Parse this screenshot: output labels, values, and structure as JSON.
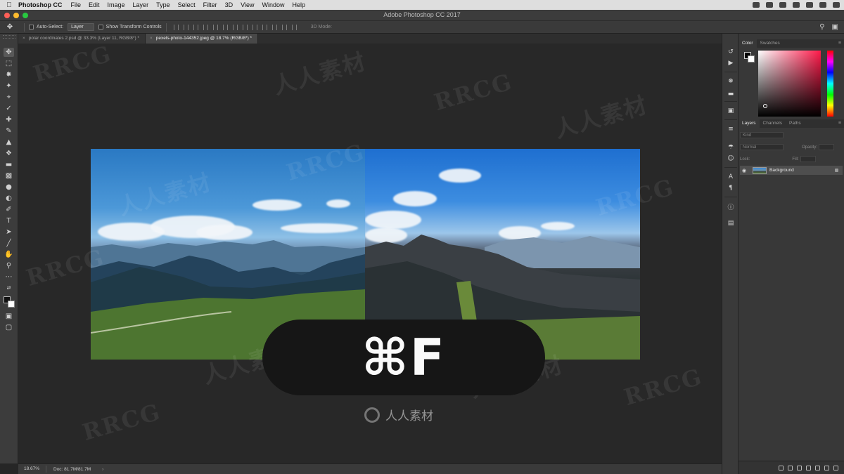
{
  "menubar": {
    "app_name": "Photoshop CC",
    "items": [
      "File",
      "Edit",
      "Image",
      "Layer",
      "Type",
      "Select",
      "Filter",
      "3D",
      "View",
      "Window",
      "Help"
    ]
  },
  "titlebar": {
    "title": "Adobe Photoshop CC 2017"
  },
  "options": {
    "auto_select_label": "Auto-Select:",
    "auto_select_value": "Layer",
    "transform_label": "Show Transform Controls",
    "mode_3d": "3D Mode:"
  },
  "tabs": [
    {
      "label": "polar coordinates 2.psd @ 33.3% (Layer 11, RGB/8*) *"
    },
    {
      "label": "pexels-photo-144352.jpeg @ 18.7% (RGB/8*) *"
    }
  ],
  "shortcut": {
    "text": "⌘F"
  },
  "status": {
    "zoom": "18.67%",
    "doc": "Doc: 81.7M/81.7M"
  },
  "color_panel": {
    "tabs": [
      "Color",
      "Swatches"
    ]
  },
  "layers_panel": {
    "tabs": [
      "Layers",
      "Channels",
      "Paths"
    ],
    "kind": "Kind",
    "blend_mode": "Normal",
    "opacity_label": "Opacity:",
    "lock_label": "Lock:",
    "fill_label": "Fill:",
    "layers": [
      {
        "name": "Background",
        "visible": true
      }
    ]
  },
  "watermark": {
    "text": "RRCG",
    "logo_text": "人人素材",
    "cn_text": "人人素材"
  },
  "icons": {
    "move_tool": "move-icon",
    "search": "search-icon",
    "workspace": "workspace-icon"
  },
  "colors": {
    "ui_dark": "#262626",
    "panel": "#383838",
    "picker_hue": "#ff1a4a"
  }
}
